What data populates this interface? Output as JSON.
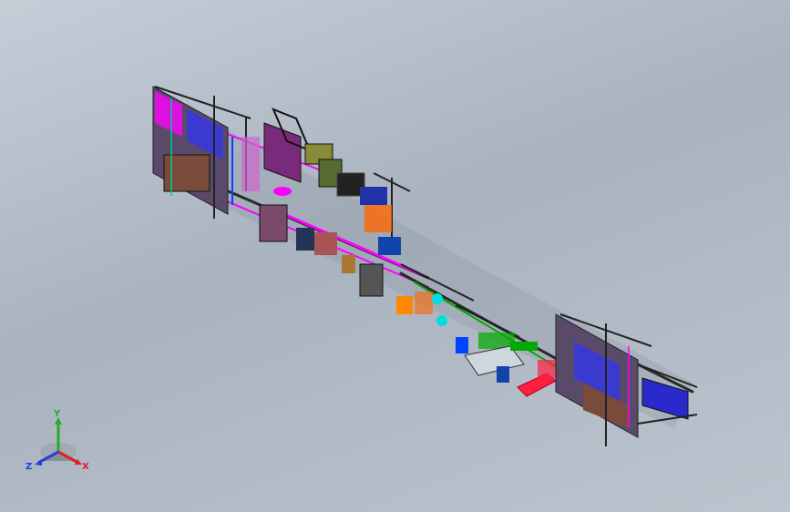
{
  "window": {
    "type": "cad-3d-viewport"
  },
  "triad": {
    "x_label": "X",
    "y_label": "Y",
    "z_label": "Z",
    "x_color": "#e02020",
    "y_color": "#20b020",
    "z_color": "#2040e0"
  },
  "model": {
    "description_icon": "assembly-line-model",
    "palette": [
      "#ff00ff",
      "#0000ff",
      "#00ffff",
      "#00aa00",
      "#ff6600",
      "#ff2040",
      "#7a2a7a",
      "#223355",
      "#556b2f"
    ]
  }
}
